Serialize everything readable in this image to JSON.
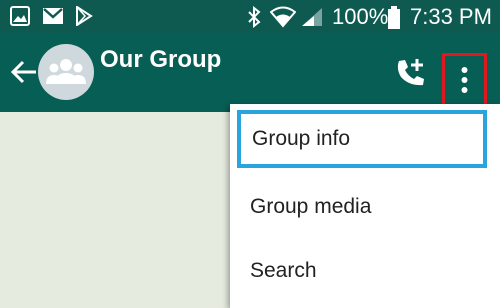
{
  "status_bar": {
    "icons": [
      "gallery-icon",
      "gmail-icon",
      "play-store-icon",
      "bluetooth-icon",
      "wifi-icon",
      "signal-icon",
      "battery-icon"
    ],
    "battery": "100%",
    "time": "7:33 PM"
  },
  "header": {
    "title": "Our Group",
    "icons": [
      "back-arrow-icon",
      "group-avatar-icon",
      "add-call-icon",
      "more-options-icon"
    ],
    "highlight_color": "#e0191e",
    "bar_color": "#075e54"
  },
  "menu": {
    "items": [
      {
        "label": "Group info"
      },
      {
        "label": "Group media"
      },
      {
        "label": "Search"
      }
    ],
    "highlight_color": "#2aa4de"
  }
}
